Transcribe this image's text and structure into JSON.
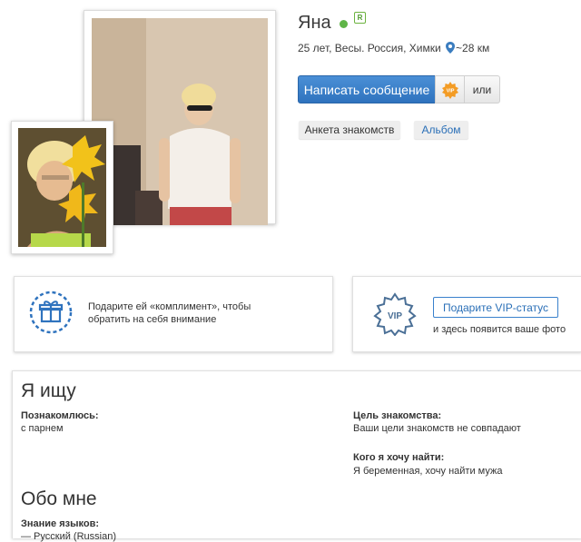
{
  "profile": {
    "name": "Яна",
    "reg_badge": "R",
    "details": "25 лет, Весы. Россия, Химки",
    "distance": "~28 км"
  },
  "actions": {
    "write_label": "Написать сообщение",
    "or_label": "или",
    "gift_badge": "VIP"
  },
  "tabs": [
    {
      "label": "Анкета знакомств"
    },
    {
      "label": "Альбом"
    }
  ],
  "promo": {
    "compliment_text": "Подарите ей «комплимент», чтобы обратить на себя внимание",
    "vip_badge": "VIP",
    "vip_button": "Подарите VIP-статус",
    "vip_hint": "и здесь появится ваше фото"
  },
  "seeking": {
    "title": "Я ищу",
    "meet_label": "Познакомлюсь:",
    "meet_value": "с парнем",
    "goal_label": "Цель знакомства:",
    "goal_value": "Ваши цели знакомств не совпадают",
    "who_label": "Кого я хочу найти:",
    "who_value": "Я беременная, хочу найти мужа"
  },
  "about": {
    "title": "Обо мне",
    "lang_label": "Знание языков:",
    "lang_value": "— Русский (Russian)"
  },
  "colors": {
    "accent": "#2f73be",
    "online": "#5fb548",
    "link": "#2a6fb7"
  }
}
